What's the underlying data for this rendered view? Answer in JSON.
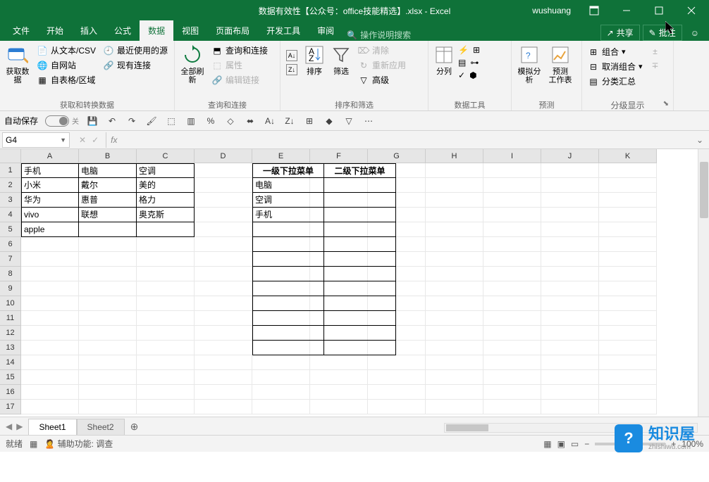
{
  "window": {
    "title": "数据有效性【公众号：office技能精选】.xlsx - Excel",
    "user": "wushuang"
  },
  "menu": {
    "tabs": [
      "文件",
      "开始",
      "插入",
      "公式",
      "数据",
      "视图",
      "页面布局",
      "开发工具",
      "审阅"
    ],
    "active": 4,
    "search": "操作说明搜索",
    "share": "共享",
    "comment": "批注"
  },
  "ribbon": {
    "g0": {
      "label": "获取和转换数据",
      "big": "获取数\n据",
      "items": [
        "从文本/CSV",
        "最近使用的源",
        "自网站",
        "现有连接",
        "自表格/区域"
      ]
    },
    "g1": {
      "label": "查询和连接",
      "big": "全部刷新",
      "items": [
        "查询和连接",
        "属性",
        "编辑链接"
      ]
    },
    "g2": {
      "label": "排序和筛选",
      "sort": "排序",
      "filter": "筛选",
      "items": [
        "清除",
        "重新应用",
        "高级"
      ]
    },
    "g3": {
      "label": "数据工具",
      "big": "分列"
    },
    "g4": {
      "label": "预测",
      "a": "模拟分析",
      "b": "预测\n工作表"
    },
    "g5": {
      "label": "分级显示",
      "items": [
        "组合",
        "取消组合",
        "分类汇总"
      ]
    }
  },
  "qat": {
    "autosave": "自动保存",
    "off": "关"
  },
  "formula": {
    "cellref": "G4"
  },
  "grid": {
    "cols": [
      "A",
      "B",
      "C",
      "D",
      "E",
      "F",
      "G",
      "H",
      "I",
      "J",
      "K"
    ],
    "rows": [
      "1",
      "2",
      "3",
      "4",
      "5",
      "6",
      "7",
      "8",
      "9",
      "10",
      "11",
      "12",
      "13",
      "14",
      "15",
      "16",
      "17"
    ],
    "data": {
      "A1": "手机",
      "B1": "电脑",
      "C1": "空调",
      "A2": "小米",
      "B2": "戴尔",
      "C2": "美的",
      "A3": "华为",
      "B3": "惠普",
      "C3": "格力",
      "A4": "vivo",
      "B4": "联想",
      "C4": "奥克斯",
      "A5": "apple",
      "E1": "一级下拉菜单",
      "F1": "二级下拉菜单",
      "E2": "电脑",
      "E3": "空调",
      "E4": "手机"
    }
  },
  "sheets": {
    "tabs": [
      "Sheet1",
      "Sheet2"
    ],
    "active": 0
  },
  "status": {
    "ready": "就绪",
    "access": "辅助功能: 调查",
    "zoom": "100%"
  },
  "watermark": {
    "main": "知识屋",
    "sub": "zhishiwu.com"
  }
}
